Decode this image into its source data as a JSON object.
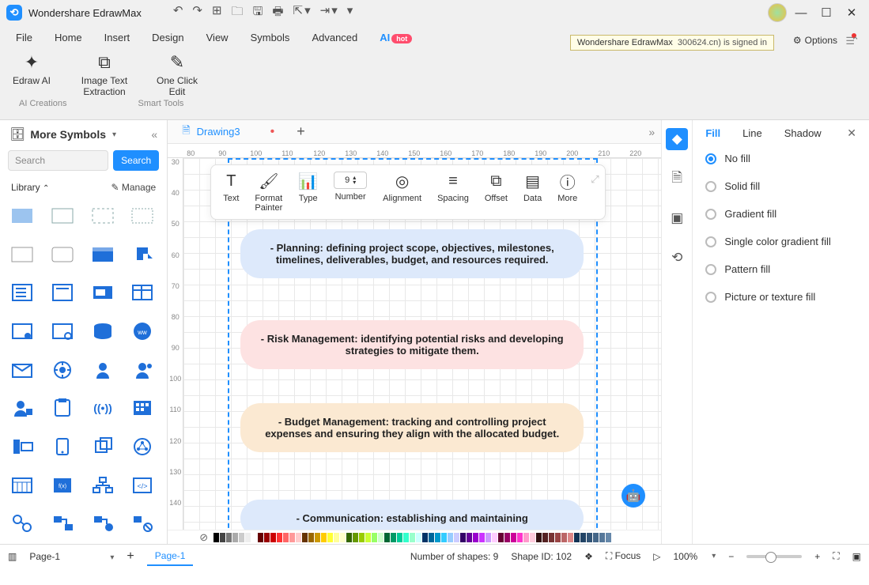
{
  "app_title": "Wondershare EdrawMax",
  "tooltip": "Wondershare EdrawMax",
  "signed_in_suffix": "300624.cn) is signed in",
  "options_label": "Options",
  "menu": [
    "File",
    "Home",
    "Insert",
    "Design",
    "View",
    "Symbols",
    "Advanced"
  ],
  "menu_ai": "AI",
  "hot_badge": "hot",
  "ribbon": {
    "items": [
      {
        "label": "Edraw AI",
        "sub": ""
      },
      {
        "label": "Image Text Extraction"
      },
      {
        "label": "One Click Edit"
      }
    ],
    "group1": "AI Creations",
    "group2": "Smart Tools"
  },
  "left": {
    "title": "More Symbols",
    "search_ph": "Search",
    "search_btn": "Search",
    "library": "Library",
    "manage": "Manage"
  },
  "doc_tab": "Drawing3",
  "ruler_h": [
    "80",
    "90",
    "100",
    "110",
    "120",
    "130",
    "140",
    "150",
    "160",
    "170",
    "180",
    "190",
    "200",
    "210",
    "220"
  ],
  "ruler_v": [
    "30",
    "40",
    "50",
    "60",
    "70",
    "80",
    "90",
    "100",
    "110",
    "120",
    "130",
    "140"
  ],
  "float_tb": {
    "text": "Text",
    "format": "Format Painter",
    "type": "Type",
    "number_lbl": "Number",
    "number_val": "9",
    "alignment": "Alignment",
    "spacing": "Spacing",
    "offset": "Offset",
    "data": "Data",
    "more": "More"
  },
  "cards": {
    "c1": "- Planning: defining project scope, objectives, milestones, timelines, deliverables, budget, and resources required.",
    "c2": "- Risk Management: identifying potential risks and developing strategies to mitigate them.",
    "c3": "- Budget Management: tracking and controlling project expenses and ensuring they align with the allocated budget.",
    "c4": "- Communication: establishing and maintaining"
  },
  "right_panel": {
    "tabs": {
      "fill": "Fill",
      "line": "Line",
      "shadow": "Shadow"
    },
    "options": [
      "No fill",
      "Solid fill",
      "Gradient fill",
      "Single color gradient fill",
      "Pattern fill",
      "Picture or texture fill"
    ],
    "selected": 0
  },
  "status": {
    "page_sel": "Page-1",
    "page_tab": "Page-1",
    "shapes": "Number of shapes: 9",
    "shape_id": "Shape ID: 102",
    "focus": "Focus",
    "zoom": "100%"
  },
  "swatches": [
    "#000",
    "#444",
    "#777",
    "#aaa",
    "#ccc",
    "#eee",
    "#fff",
    "#600",
    "#900",
    "#c00",
    "#f33",
    "#f66",
    "#f99",
    "#fcc",
    "#630",
    "#960",
    "#c90",
    "#fc0",
    "#ff3",
    "#ff9",
    "#ffc",
    "#360",
    "#690",
    "#9c0",
    "#cf3",
    "#9f6",
    "#cfc",
    "#063",
    "#096",
    "#0c9",
    "#3fc",
    "#9fc",
    "#cff",
    "#036",
    "#069",
    "#09c",
    "#3cf",
    "#9cf",
    "#ccf",
    "#306",
    "#609",
    "#90c",
    "#c3f",
    "#c9f",
    "#fcf",
    "#603",
    "#906",
    "#c09",
    "#f3c",
    "#f9c",
    "#fcd",
    "#311",
    "#522",
    "#733",
    "#944",
    "#b66",
    "#d88",
    "#135",
    "#246",
    "#357",
    "#468",
    "#579",
    "#68a"
  ]
}
